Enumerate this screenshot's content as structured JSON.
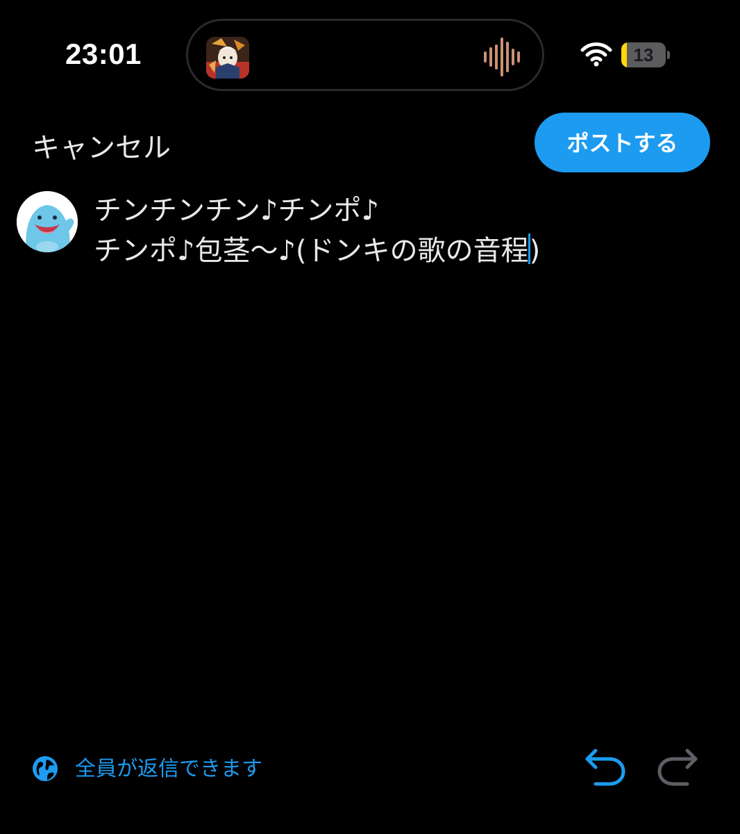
{
  "status_bar": {
    "time": "23:01",
    "battery_level": "13",
    "battery_fraction": 0.13,
    "battery_color": "#ffd60a",
    "now_playing_icon": "audio-waveform-icon",
    "signal_icon": "wifi-icon"
  },
  "header": {
    "cancel_label": "キャンセル",
    "post_label": "ポストする"
  },
  "compose": {
    "line1": "チンチンチン♪チンポ♪",
    "line2_before_caret": "チンポ♪包茎〜♪(ドンキの歌の音程",
    "line2_after_caret": ")",
    "avatar_icon": "user-avatar"
  },
  "footer": {
    "reply_setting_label": "全員が返信できます",
    "reply_setting_icon": "globe-icon",
    "undo_icon": "undo-icon",
    "redo_icon": "redo-icon"
  },
  "colors": {
    "background": "#000000",
    "accent": "#1d9bf0",
    "text": "#e7e9ea",
    "disabled": "#5c5f63"
  }
}
